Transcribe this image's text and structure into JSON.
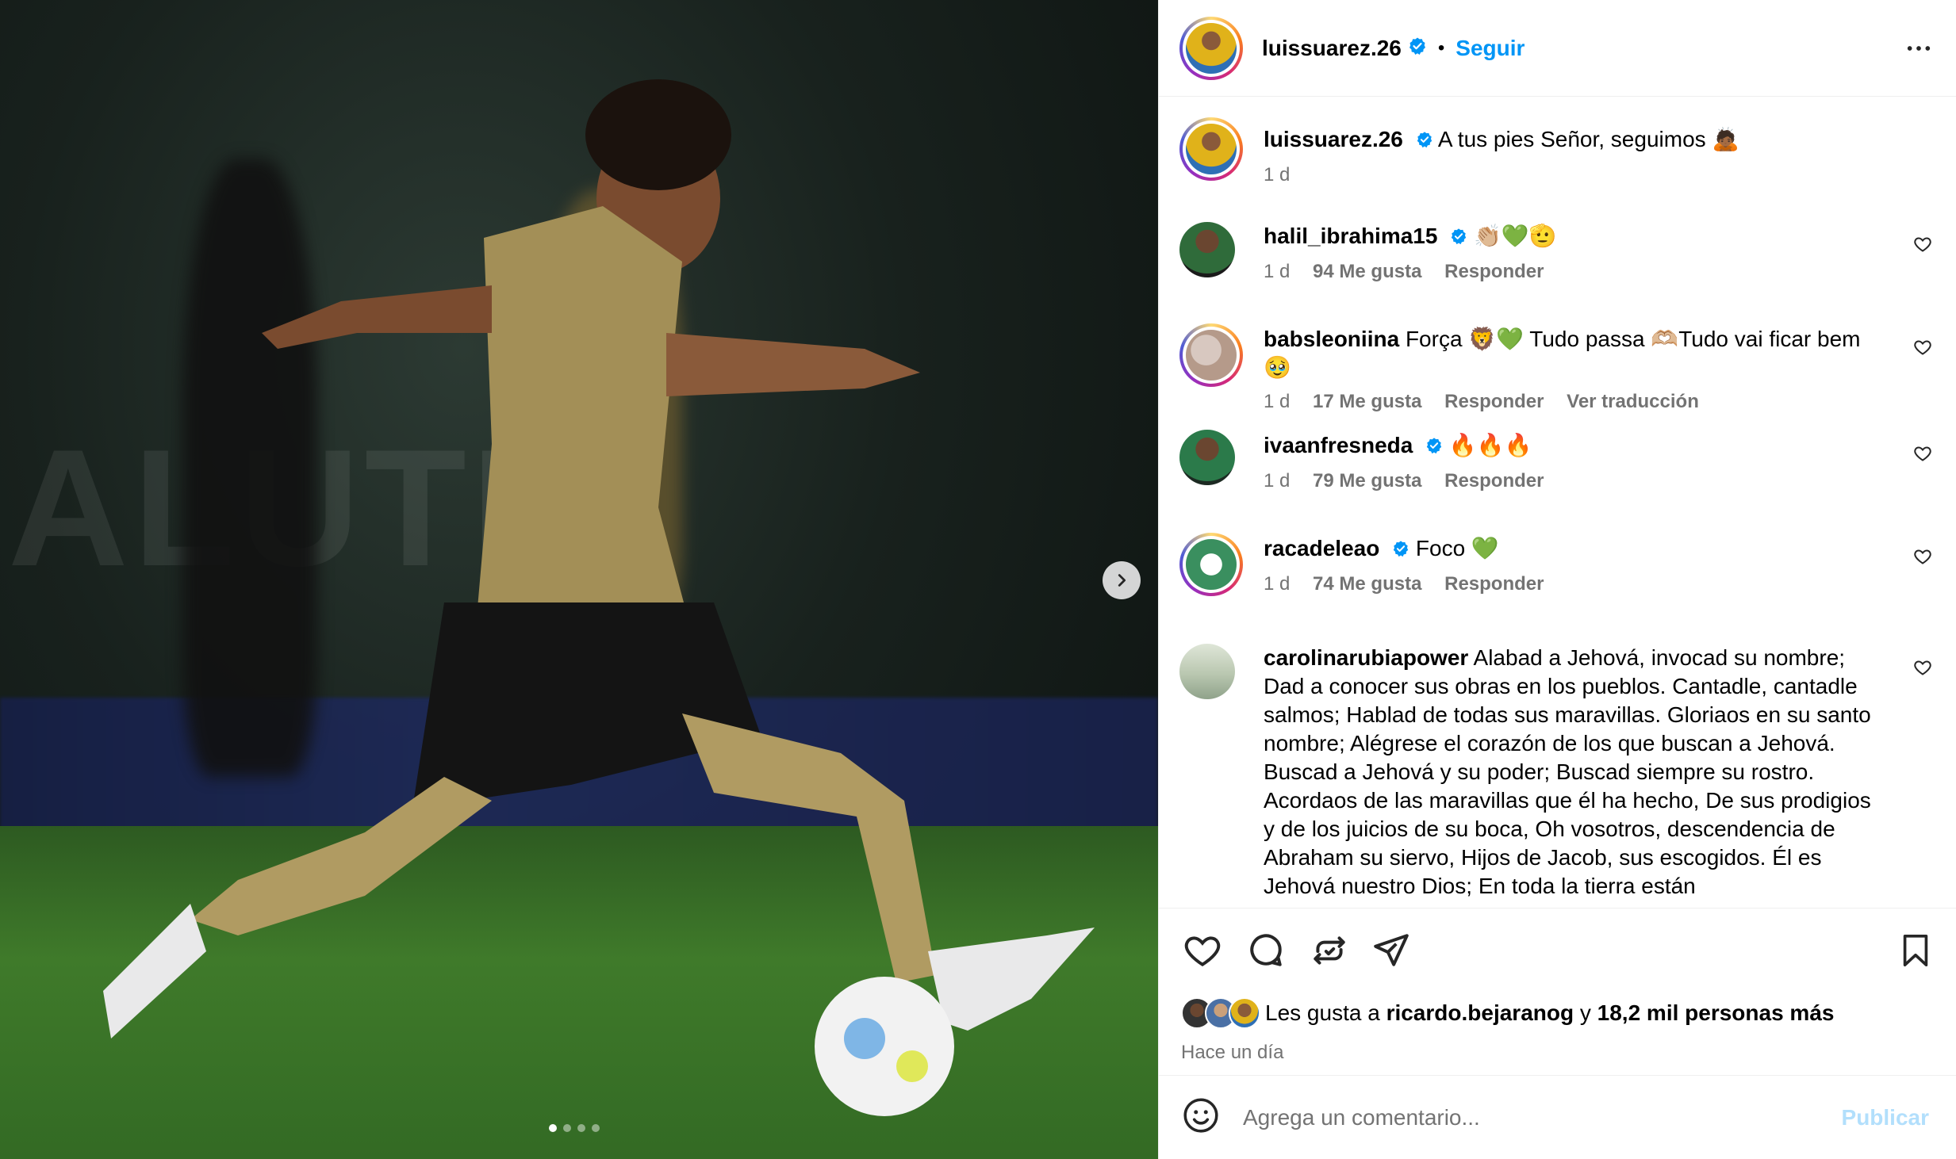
{
  "post": {
    "author": "luissuarez.26",
    "follow_label": "Seguir",
    "separator": "•",
    "carousel": {
      "total_slides": 4,
      "active_slide": 1
    }
  },
  "caption": {
    "username": "luissuarez.26",
    "text": "A tus pies Señor, seguimos 🙇🏾",
    "time": "1 d"
  },
  "comments": [
    {
      "username": "halil_ibrahima15",
      "verified": true,
      "text": "👏🏼💚🫡",
      "time": "1 d",
      "likes": "94 Me gusta",
      "reply": "Responder",
      "translate": ""
    },
    {
      "username": "babsleoniina",
      "verified": false,
      "text": "Força 🦁💚 Tudo passa 🫶🏼Tudo vai ficar bem 🥹",
      "time": "1 d",
      "likes": "17 Me gusta",
      "reply": "Responder",
      "translate": "Ver traducción"
    },
    {
      "username": "ivaanfresneda",
      "verified": true,
      "text": "🔥🔥🔥",
      "time": "1 d",
      "likes": "79 Me gusta",
      "reply": "Responder",
      "translate": ""
    },
    {
      "username": "racadeleao",
      "verified": true,
      "text": "Foco 💚",
      "time": "1 d",
      "likes": "74 Me gusta",
      "reply": "Responder",
      "translate": ""
    },
    {
      "username": "carolinarubiapower",
      "verified": false,
      "text": "Alabad a Jehová, invocad su nombre; Dad a conocer sus obras en los pueblos. Cantadle, cantadle salmos; Hablad de todas sus maravillas. Gloriaos en su santo nombre; Alégrese el corazón de los que buscan a Jehová. Buscad a Jehová y su poder; Buscad siempre su rostro. Acordaos de las maravillas que él ha hecho, De sus prodigios y de los juicios de su boca, Oh vosotros, descendencia de Abraham su siervo, Hijos de Jacob, sus escogidos. Él es Jehová nuestro Dios; En toda la tierra están",
      "time": "",
      "likes": "",
      "reply": "",
      "translate": ""
    }
  ],
  "likes": {
    "prefix": "Les gusta a",
    "user": "ricardo.bejaranog",
    "conj": "y",
    "others": "18,2 mil personas más",
    "time_ago": "Hace un día"
  },
  "composer": {
    "placeholder": "Agrega un comentario...",
    "publish_label": "Publicar"
  },
  "icons": {
    "verified": "verified-badge-icon",
    "more": "more-options-icon",
    "like": "heart-icon",
    "comment": "comment-icon",
    "repost": "repost-icon",
    "share": "share-icon",
    "save": "bookmark-icon",
    "emoji": "emoji-icon",
    "next": "chevron-right-icon"
  },
  "colors": {
    "accent": "#0095f6",
    "muted": "#737373",
    "publish_disabled": "#b2dffc",
    "divider": "#efefef"
  }
}
